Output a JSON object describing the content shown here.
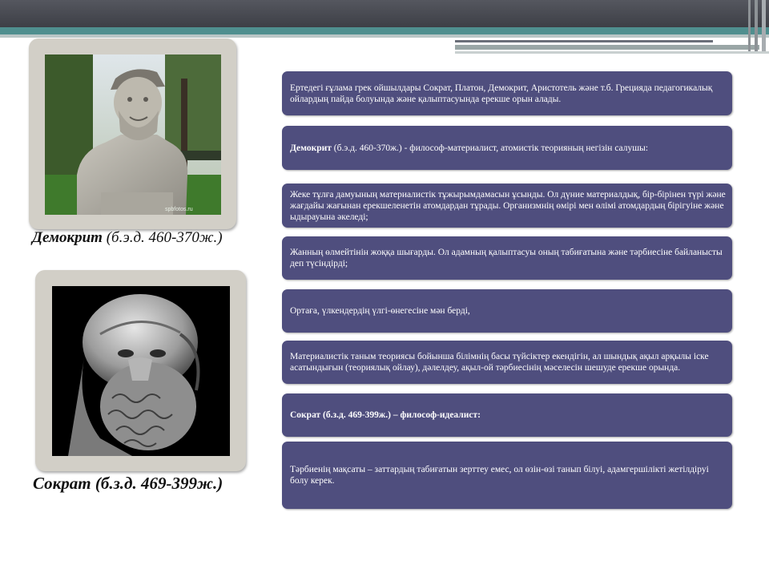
{
  "decor": {
    "accent": "#4f8f8f",
    "box_color": "#4f4e7e",
    "top_bar": "#45474e"
  },
  "left": {
    "democritus": {
      "photo_icon": "democritus-bust-photo",
      "watermark": "spbfotos.ru",
      "caption_name": "Демокрит",
      "caption_dates": "(б.э.д. 460-370ж.)"
    },
    "socrates": {
      "photo_icon": "socrates-bust-photo",
      "caption": "Сократ (б.з.д. 469-399ж.)"
    }
  },
  "boxes": {
    "b1": "Ертедегі ғұлама грек ойшылдары Сократ, Платон, Демокрит, Аристотель және т.б. Грецияда педагогикалық ойлардың пайда болуында және қалыптасуында ерекше орын алады.",
    "b2_bold": "Демокрит",
    "b2_rest": " (б.э.д. 460-370ж.) - философ-материалист, атомистік теорияның негізін салушы:",
    "b3": "Жеке тұлға дамуының материалистік тұжырымдамасын ұсынды. Ол дүние материалдық, бір-бірінен түрі және жағдайы жағынан ерекшеленетін атомдардан тұрады. Организмнің өмірі мен өлімі атомдардың бірігуіне және ыдырауына әкеледі;",
    "b4": "Жанның өлмейтінін жоққа шығарды. Ол адамның қалыптасуы оның табиғатына және тәрбиесіне байланысты деп түсіндірді;",
    "b5": "Ортаға, үлкендердің үлгі-өнегесіне мән берді,",
    "b6": "Материалистік таным теориясы бойынша білімнің басы түйсіктер екендігін, ал шындық ақыл арқылы іске асатындығын (теориялық ойлау), дәлелдеу, ақыл-ой тәрбиесінің мәселесін шешуде ерекше орында.",
    "b7": "Сократ (б.з.д. 469-399ж.) – философ-идеалист:",
    "b8": "Тәрбиенің мақсаты – заттардың табиғатын зерттеу емес, ол өзін-өзі танып білуі, адамгершілікті жетілдіруі болу керек."
  }
}
